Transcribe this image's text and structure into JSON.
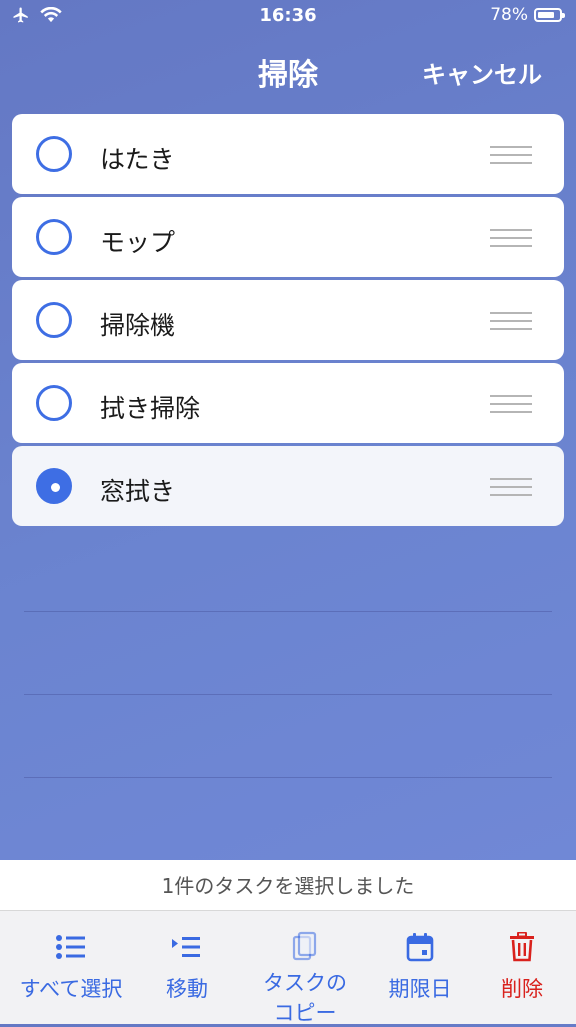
{
  "status_bar": {
    "time": "16:36",
    "battery": "78%",
    "icons": [
      "airplane-icon",
      "wifi-icon",
      "battery-icon"
    ]
  },
  "nav": {
    "title": "掃除",
    "cancel_label": "キャンセル"
  },
  "tasks": [
    {
      "label": "はたき",
      "selected": false
    },
    {
      "label": "モップ",
      "selected": false
    },
    {
      "label": "掃除機",
      "selected": false
    },
    {
      "label": "拭き掃除",
      "selected": false
    },
    {
      "label": "窓拭き",
      "selected": true
    }
  ],
  "selection_message": "1件のタスクを選択しました",
  "toolbar": {
    "select_all": "すべて選択",
    "move": "移動",
    "copy_line1": "タスクの",
    "copy_line2": "コピー",
    "due_date": "期限日",
    "delete": "削除"
  },
  "colors": {
    "accent": "#3e6ee4",
    "delete": "#d9211c",
    "background": "#6b84d0"
  }
}
